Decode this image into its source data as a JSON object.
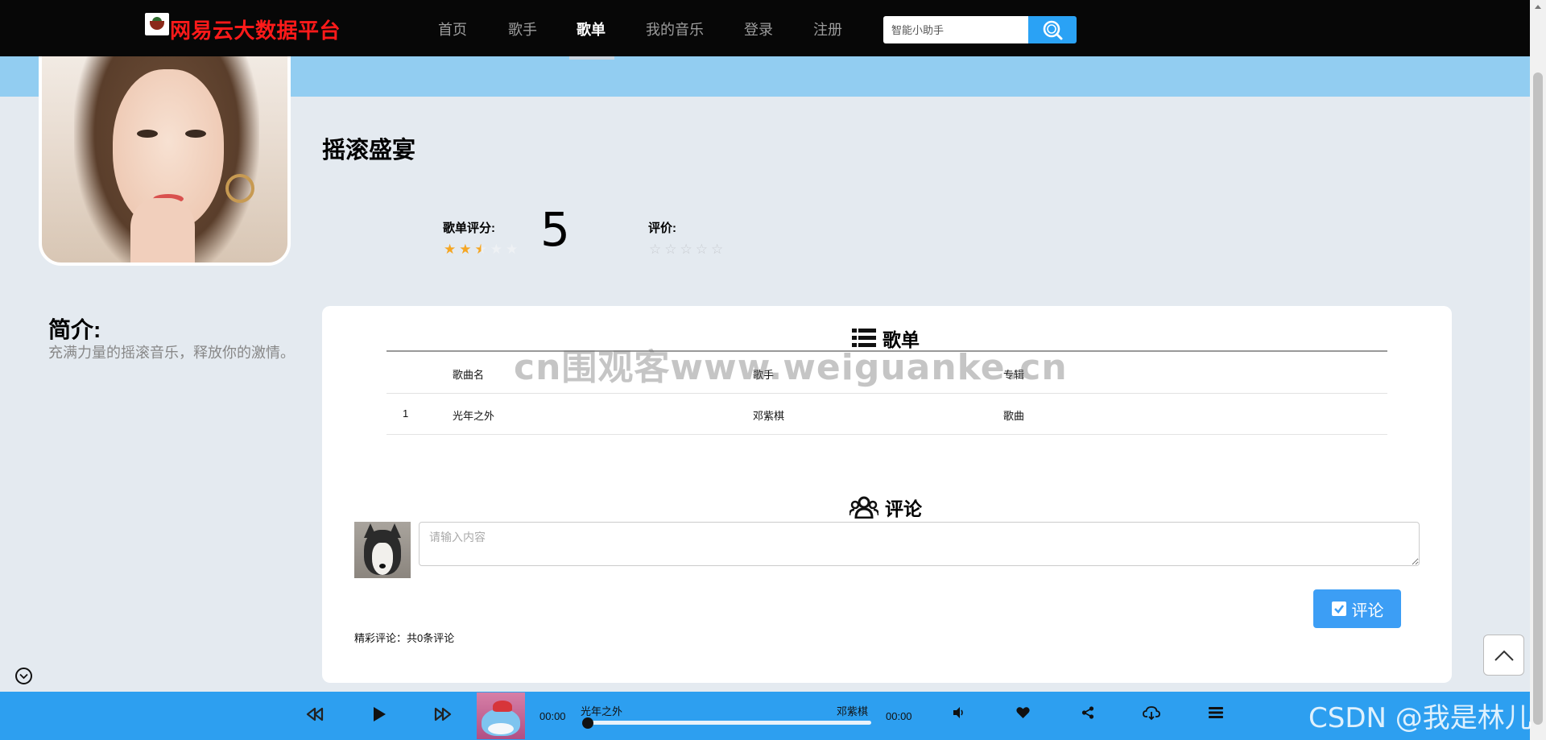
{
  "nav": {
    "brand": "网易云大数据平台",
    "items": [
      "首页",
      "歌手",
      "歌单",
      "我的音乐",
      "登录",
      "注册"
    ],
    "active": "歌单",
    "search_placeholder": "智能小助手"
  },
  "playlist": {
    "title": "摇滚盛宴",
    "rating_label": "歌单评分:",
    "rating_value": "5",
    "rating_stars": 2.5,
    "evaluate_label": "评价:",
    "evaluate_stars": 0
  },
  "intro": {
    "title": "简介:",
    "text": "充满力量的摇滚音乐，释放你的激情。"
  },
  "songs_section": {
    "heading": "歌单",
    "columns": [
      "歌曲名",
      "歌手",
      "专辑"
    ],
    "rows": [
      {
        "index": "1",
        "name": "光年之外",
        "artist": "邓紫棋",
        "album": "歌曲"
      }
    ]
  },
  "comments_section": {
    "heading": "评论",
    "input_placeholder": "请输入内容",
    "submit_label": "评论",
    "count_text": "精彩评论：共0条评论"
  },
  "watermark": "cn围观客www.weiguanke.cn",
  "player": {
    "song": "光年之外",
    "artist": "邓紫棋",
    "current_time": "00:00",
    "total_time": "00:00",
    "progress": 0
  },
  "corner_watermark": "CSDN @我是林儿",
  "colors": {
    "nav_bg": "#070707",
    "brand": "#ff1a1a",
    "banner": "#92cdf1",
    "accent": "#2d9ff0",
    "star": "#f5a623"
  }
}
